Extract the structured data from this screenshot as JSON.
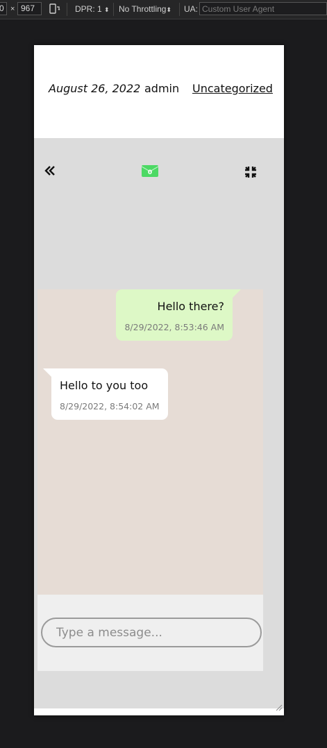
{
  "devtools": {
    "width_value": "0",
    "height_value": "967",
    "times_sign": "×",
    "dpr_label": "DPR: 1",
    "throttle_label": "No Throttling",
    "ua_label": "UA:",
    "ua_placeholder": "Custom User Agent"
  },
  "post_meta": {
    "date": "August 26, 2022",
    "author": "admin",
    "category": "Uncategorized"
  },
  "chat": {
    "header": {
      "back_icon": "double-chevron-left-icon",
      "inbox_icon": "envelope-icon",
      "inbox_count": "0",
      "inbox_color": "#4cd964",
      "minimize_icon": "compress-icon"
    },
    "messages": [
      {
        "direction": "outgoing",
        "text": "Hello there?",
        "time": "8/29/2022, 8:53:46 AM",
        "color": "#ddf8c6"
      },
      {
        "direction": "incoming",
        "text": "Hello to you too",
        "time": "8/29/2022, 8:54:02 AM",
        "color": "#ffffff"
      }
    ],
    "input_placeholder": "Type a message..."
  }
}
